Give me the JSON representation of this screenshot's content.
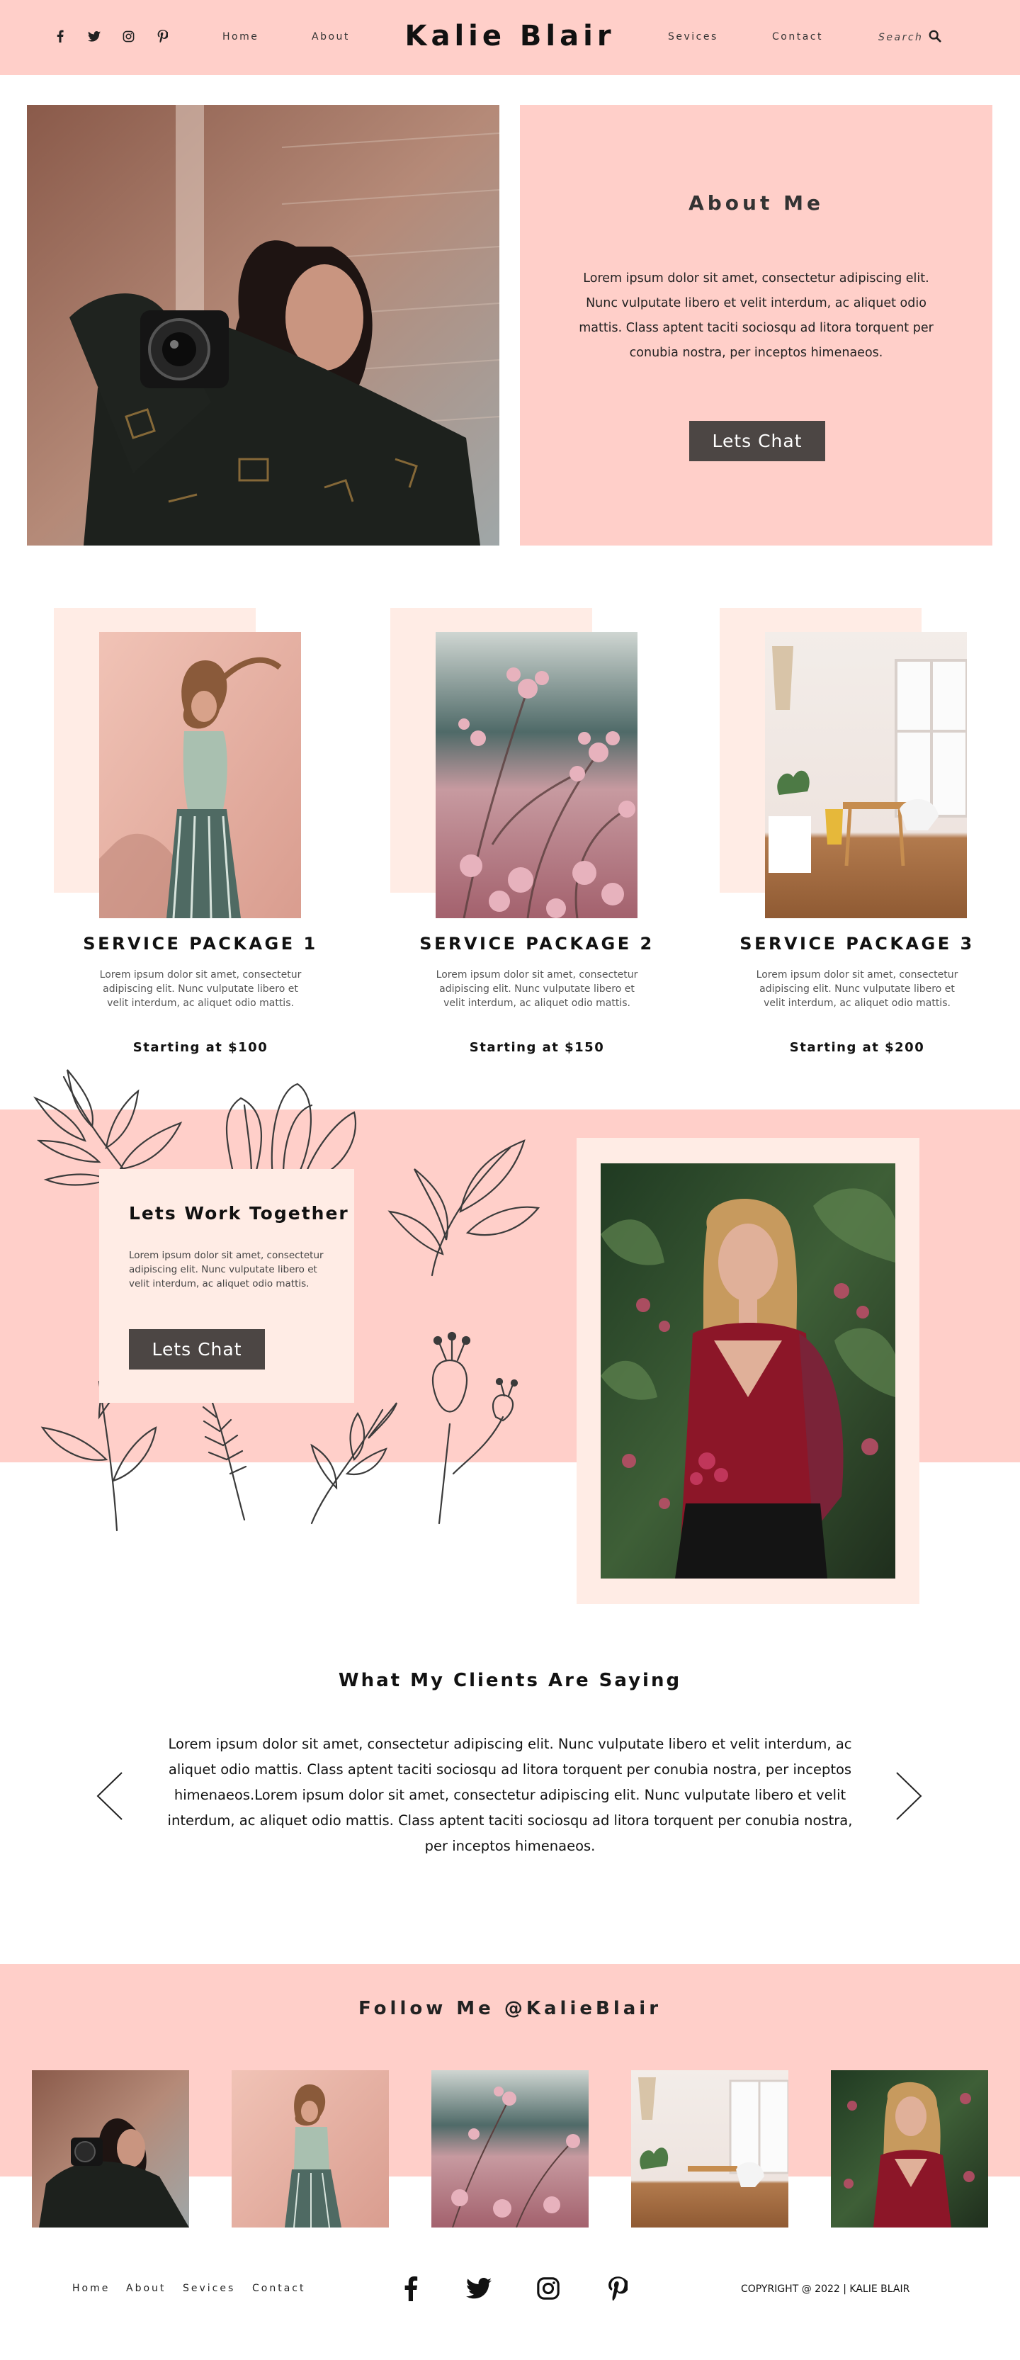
{
  "header": {
    "brand": "Kalie Blair",
    "nav_left": [
      "Home",
      "About"
    ],
    "nav_right": [
      "Sevices",
      "Contact"
    ],
    "search_label": "Search",
    "social_icons": [
      "facebook-icon",
      "twitter-icon",
      "instagram-icon",
      "pinterest-icon"
    ]
  },
  "about": {
    "title": "About Me",
    "text": "Lorem ipsum dolor sit amet, consectetur adipiscing elit. Nunc vulputate libero et velit interdum, ac aliquet odio mattis. Class aptent taciti sociosqu ad litora torquent per conubia nostra, per inceptos himenaeos.",
    "button": "Lets Chat"
  },
  "packages": [
    {
      "title": "SERVICE PACKAGE 1",
      "desc": "Lorem ipsum dolor sit amet, consectetur adipiscing elit. Nunc vulputate libero et velit interdum, ac aliquet odio mattis.",
      "price": "Starting at $100"
    },
    {
      "title": "SERVICE PACKAGE 2",
      "desc": "Lorem ipsum dolor sit amet, consectetur adipiscing elit. Nunc vulputate libero et velit interdum, ac aliquet odio mattis.",
      "price": "Starting at $150"
    },
    {
      "title": "SERVICE PACKAGE 3",
      "desc": "Lorem ipsum dolor sit amet, consectetur adipiscing elit. Nunc vulputate libero et velit interdum, ac aliquet odio mattis.",
      "price": "Starting at $200"
    }
  ],
  "work": {
    "title": "Lets Work Together",
    "text": "Lorem ipsum dolor sit amet, consectetur adipiscing elit. Nunc vulputate libero et velit interdum, ac aliquet odio mattis.",
    "button": "Lets Chat"
  },
  "testimonials": {
    "title": "What My Clients Are Saying",
    "text": "Lorem ipsum dolor sit amet, consectetur adipiscing elit. Nunc vulputate libero et velit interdum, ac aliquet odio mattis. Class aptent taciti sociosqu ad litora torquent per conubia nostra, per inceptos himenaeos.Lorem ipsum dolor sit amet, consectetur adipiscing elit. Nunc vulputate libero et velit interdum, ac aliquet odio mattis. Class aptent taciti sociosqu ad litora torquent per conubia nostra, per inceptos himenaeos."
  },
  "follow": {
    "title": "Follow Me @KalieBlair"
  },
  "footer": {
    "nav": [
      "Home",
      "About",
      "Sevices",
      "Contact"
    ],
    "copyright": "COPYRIGHT @ 2022 | KALIE BLAIR",
    "social_icons": [
      "facebook-icon",
      "twitter-icon",
      "instagram-icon",
      "pinterest-icon"
    ]
  },
  "colors": {
    "pink": "#ffcfc9",
    "cream": "#ffece5",
    "button": "#4c4644"
  }
}
